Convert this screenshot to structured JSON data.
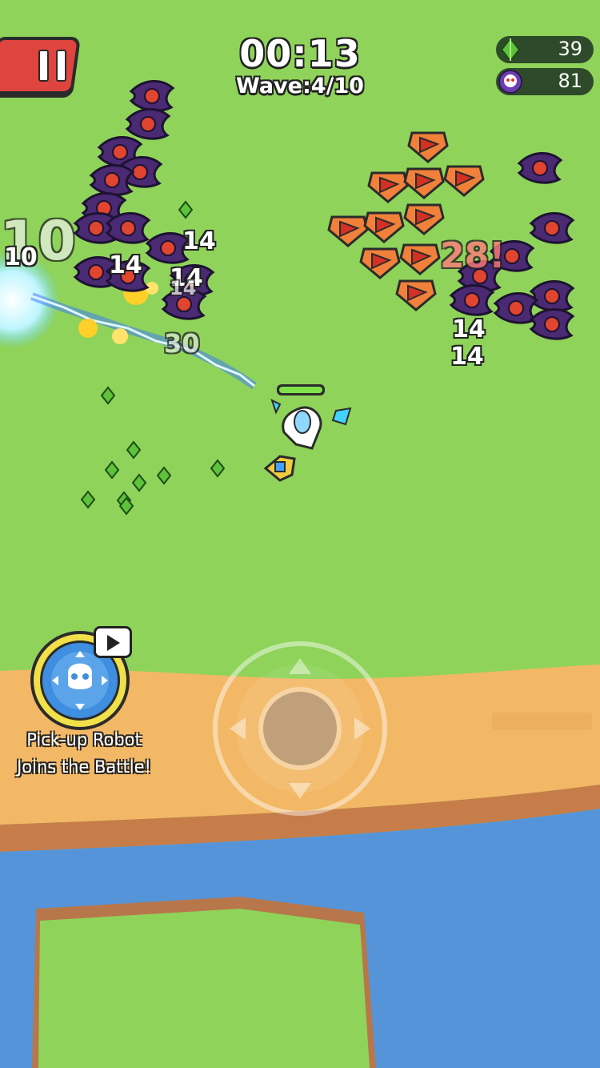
{
  "hud": {
    "timer": "00:13",
    "wave": "Wave:4/10",
    "gems": "39",
    "kills": "81"
  },
  "robot_promo": {
    "line1": "Pick-up Robot",
    "line2": "Joins the Battle!"
  },
  "damage_numbers": [
    "10",
    "10",
    "14",
    "14",
    "14",
    "14",
    "30",
    "28!",
    "14",
    "14"
  ],
  "colors": {
    "grass": "#8fd35a",
    "sand": "#f2b866",
    "water": "#5594d9",
    "pause_red": "#e0443e",
    "enemy_purple": "#4a2a72",
    "enemy_red": "#e0452f",
    "gem_green": "#5ec23a"
  },
  "icons": {
    "pause": "pause-icon",
    "gem": "gem-icon",
    "kills": "skull-icon",
    "video": "video-play-icon",
    "robot": "robot-icon"
  }
}
